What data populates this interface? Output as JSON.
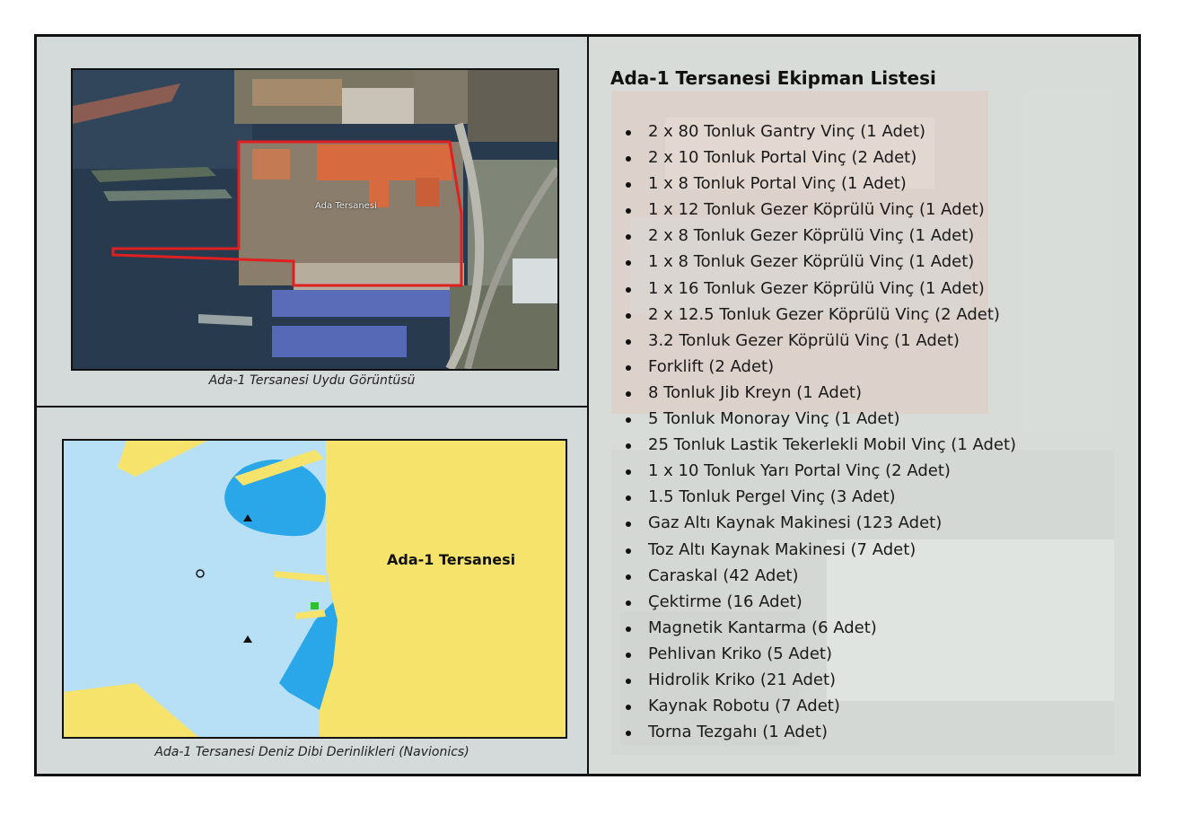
{
  "left_top": {
    "caption": "Ada-1 Tersanesi Uydu Görüntüsü",
    "map_label": "Ada Tersanesi"
  },
  "left_bottom": {
    "caption": "Ada-1 Tersanesi Deniz Dibi Derinlikleri (Navionics)",
    "pointer_label": "Ada-1 Tersanesi"
  },
  "equipment": {
    "title": "Ada-1 Tersanesi Ekipman Listesi",
    "items": [
      "2 x 80 Tonluk Gantry Vinç (1 Adet)",
      "2 x 10 Tonluk Portal Vinç (2 Adet)",
      "1 x 8 Tonluk Portal Vinç (1 Adet)",
      "1 x 12 Tonluk Gezer Köprülü Vinç (1 Adet)",
      "2 x 8 Tonluk Gezer Köprülü Vinç (1 Adet)",
      "1 x 8 Tonluk Gezer Köprülü Vinç (1 Adet)",
      "1 x 16 Tonluk Gezer Köprülü Vinç (1 Adet)",
      "2 x 12.5 Tonluk Gezer Köprülü Vinç (2 Adet)",
      "3.2 Tonluk Gezer Köprülü Vinç (1 Adet)",
      "Forklift (2 Adet)",
      "8 Tonluk Jib Kreyn (1 Adet)",
      "5 Tonluk Monoray Vinç (1 Adet)",
      "25 Tonluk Lastik Tekerlekli Mobil Vinç (1 Adet)",
      "1 x 10 Tonluk Yarı Portal Vinç (2 Adet)",
      "1.5 Tonluk Pergel Vinç (3 Adet)",
      "Gaz Altı Kaynak Makinesi (123 Adet)",
      "Toz Altı Kaynak Makinesi (7 Adet)",
      "Caraskal (42 Adet)",
      "Çektirme (16 Adet)",
      "Magnetik Kantarma (6 Adet)",
      "Pehlivan Kriko (5 Adet)",
      "Hidrolik Kriko (21 Adet)",
      "Kaynak Robotu (7 Adet)",
      "Torna Tezgahı (1 Adet)"
    ]
  },
  "colors": {
    "border": "#111111",
    "land": "#f6e36b",
    "shallow": "#b7e0f6",
    "deep": "#29a7e8",
    "highlight": "#e02020"
  }
}
